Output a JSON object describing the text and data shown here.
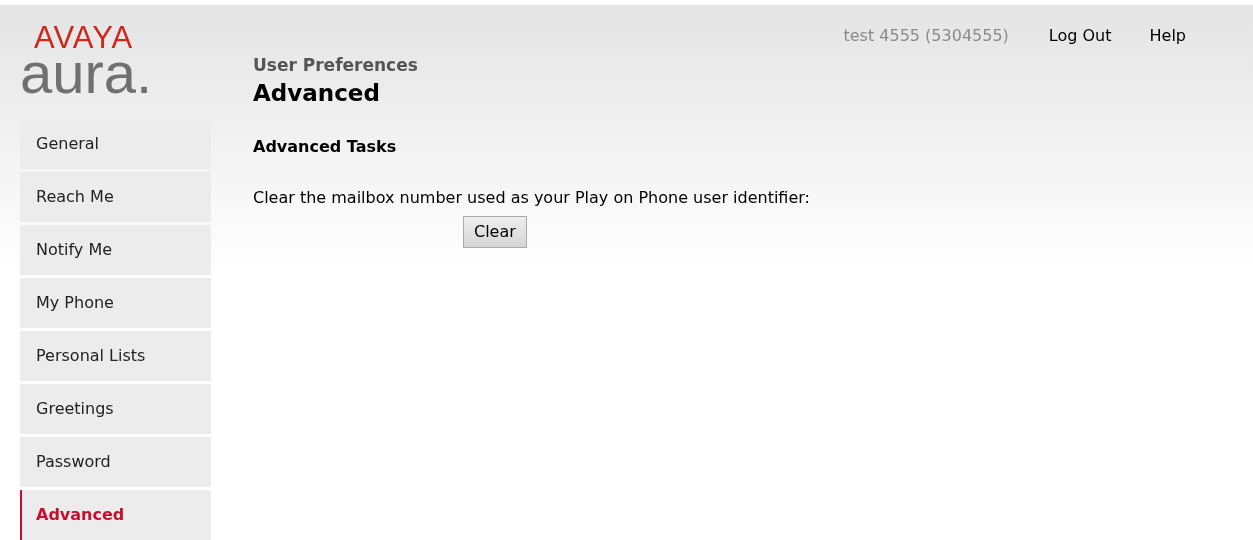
{
  "logo": {
    "brand": "AVAYA",
    "product": "aura."
  },
  "user": "test 4555 (5304555)",
  "header_links": [
    "Log Out",
    "Help"
  ],
  "sidebar": {
    "items": [
      {
        "label": "General",
        "selected": false
      },
      {
        "label": "Reach Me",
        "selected": false
      },
      {
        "label": "Notify Me",
        "selected": false
      },
      {
        "label": "My Phone",
        "selected": false
      },
      {
        "label": "Personal Lists",
        "selected": false
      },
      {
        "label": "Greetings",
        "selected": false
      },
      {
        "label": "Password",
        "selected": false
      },
      {
        "label": "Advanced",
        "selected": true
      }
    ]
  },
  "breadcrumb": "User Preferences",
  "title": "Advanced",
  "section": {
    "heading": "Advanced Tasks",
    "text": "Clear the mailbox number used as your Play on Phone user identifier:",
    "button": "Clear"
  }
}
